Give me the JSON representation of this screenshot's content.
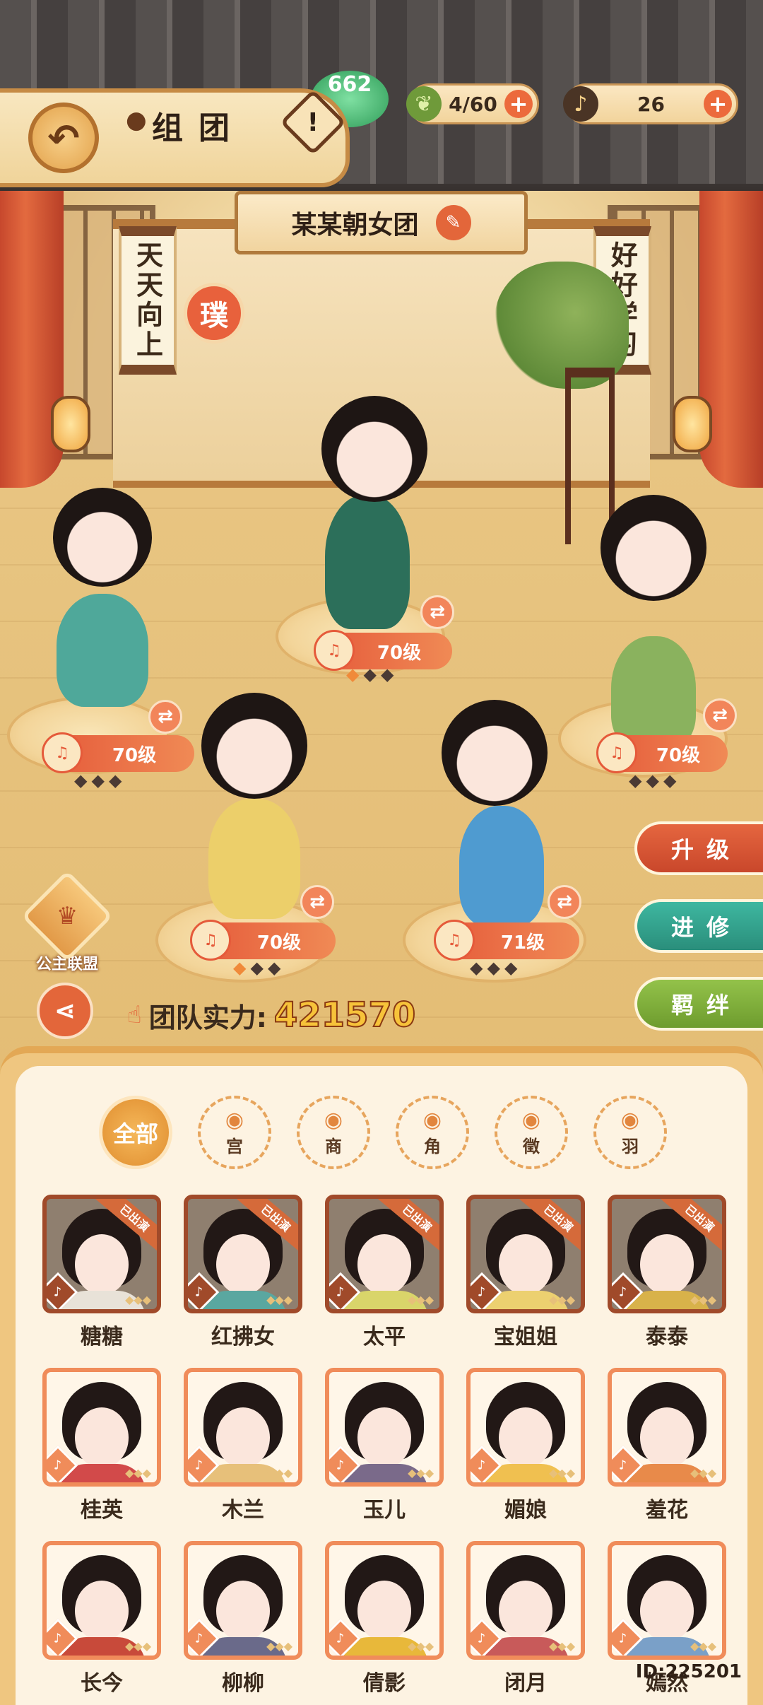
{
  "header": {
    "title": "组团",
    "back_label": "↶",
    "info_label": "!",
    "event_badge": "662",
    "resources": [
      {
        "icon": "leaf-icon",
        "value": "4/60"
      },
      {
        "icon": "microphone-icon",
        "value": "26"
      }
    ]
  },
  "team": {
    "name": "某某朝女团",
    "banner_left": "天天向上",
    "banner_right": "好好学习",
    "emblem": "璞",
    "power_label": "团队实力:",
    "power_value": "421570"
  },
  "members": [
    {
      "level": "70级",
      "stars_lit": 0,
      "robe": "#4fa89a"
    },
    {
      "level": "70级",
      "stars_lit": 1,
      "robe": "#2c6f5a"
    },
    {
      "level": "70级",
      "stars_lit": 0,
      "robe": "#8ab25e"
    },
    {
      "level": "70级",
      "stars_lit": 1,
      "robe": "#eccf6a"
    },
    {
      "level": "71级",
      "stars_lit": 0,
      "robe": "#4f9bd0"
    }
  ],
  "side_buttons": {
    "upgrade": "升级",
    "advance": "进修",
    "bond": "羁绊"
  },
  "alliance_label": "公主联盟",
  "filters": [
    {
      "label": "全部",
      "icon": ""
    },
    {
      "label": "宫",
      "icon": "drum-icon"
    },
    {
      "label": "商",
      "icon": "bell-icon"
    },
    {
      "label": "角",
      "icon": "clapper-icon"
    },
    {
      "label": "徵",
      "icon": "pipa-icon"
    },
    {
      "label": "羽",
      "icon": "flute-icon"
    }
  ],
  "roster": [
    {
      "name": "糖糖",
      "deployed": true,
      "robe": "#e8e2d8"
    },
    {
      "name": "红拂女",
      "deployed": true,
      "robe": "#5aa7a0"
    },
    {
      "name": "太平",
      "deployed": true,
      "robe": "#d9d56a"
    },
    {
      "name": "宝姐姐",
      "deployed": true,
      "robe": "#ecd070"
    },
    {
      "name": "泰泰",
      "deployed": true,
      "robe": "#d8b24a"
    },
    {
      "name": "桂英",
      "deployed": false,
      "robe": "#d24a4a"
    },
    {
      "name": "木兰",
      "deployed": false,
      "robe": "#e7c07a"
    },
    {
      "name": "玉儿",
      "deployed": false,
      "robe": "#7a6a8a"
    },
    {
      "name": "媚娘",
      "deployed": false,
      "robe": "#f0c050"
    },
    {
      "name": "羞花",
      "deployed": false,
      "robe": "#e88a4a"
    },
    {
      "name": "长今",
      "deployed": false,
      "robe": "#c84a3a"
    },
    {
      "name": "柳柳",
      "deployed": false,
      "robe": "#6a6a8a"
    },
    {
      "name": "倩影",
      "deployed": false,
      "robe": "#e8b83a"
    },
    {
      "name": "闭月",
      "deployed": false,
      "robe": "#c85a5a"
    },
    {
      "name": "嫣然",
      "deployed": false,
      "robe": "#7aa0c8"
    }
  ],
  "deployed_label": "已出演",
  "uid": "ID:225201"
}
